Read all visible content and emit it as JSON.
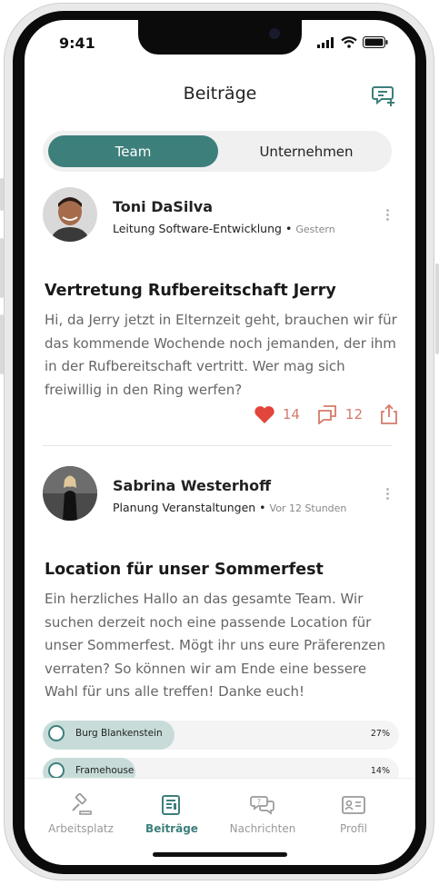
{
  "status": {
    "time": "9:41"
  },
  "header": {
    "title": "Beiträge",
    "compose_icon": "compose-message-icon"
  },
  "segment": {
    "active": "Team",
    "inactive": "Unternehmen"
  },
  "posts": [
    {
      "author": "Toni DaSilva",
      "role": "Leitung Software-Entwicklung",
      "time": "Gestern",
      "title": "Vertretung Rufbereitschaft Jerry",
      "body": "Hi, da Jerry jetzt in Elternzeit geht, brauchen wir für das kommende Wochende noch jemanden, der ihm in der Rufbereitschaft vertritt. Wer mag sich freiwillig in den Ring werfen?",
      "likes": "14",
      "comments": "12"
    },
    {
      "author": "Sabrina Westerhoff",
      "role": "Planung Veranstaltungen",
      "time": "Vor 12 Stunden",
      "title": "Location für unser Sommerfest",
      "body": "Ein herzliches Hallo an das gesamte Team. Wir suchen derzeit noch eine passende Location für unser Sommerfest. Mögt ihr uns eure Präferenzen verraten? So können wir am Ende eine bessere Wahl für uns alle treffen! Danke euch!",
      "poll": [
        {
          "label": "Burg Blankenstein",
          "pct": "27%",
          "fraction": 0.37
        },
        {
          "label": "Framehouse",
          "pct": "14%",
          "fraction": 0.26
        }
      ]
    }
  ],
  "tabs": [
    {
      "label": "Arbeitsplatz",
      "icon": "gavel-icon"
    },
    {
      "label": "Beiträge",
      "icon": "news-icon"
    },
    {
      "label": "Nachrichten",
      "icon": "chat-bubbles-icon"
    },
    {
      "label": "Profil",
      "icon": "id-card-icon"
    }
  ],
  "colors": {
    "accent": "#3d7f7b",
    "like": "#e2463a",
    "poll_fill": "#c7dcd9"
  }
}
